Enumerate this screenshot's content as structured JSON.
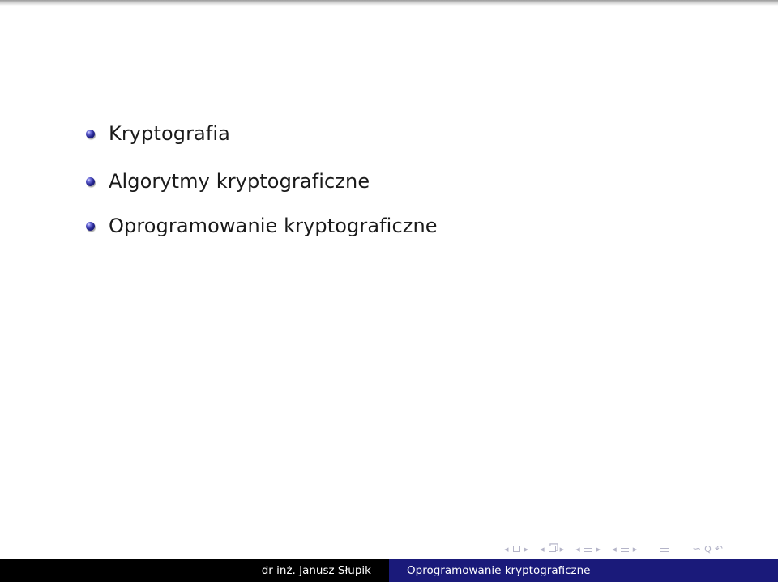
{
  "slide": {
    "items": [
      {
        "text": "Kryptografia"
      },
      {
        "text": "Algorytmy kryptograficzne"
      },
      {
        "text": "Oprogramowanie kryptograficzne"
      }
    ]
  },
  "footer": {
    "author": "dr inż. Janusz Słupik",
    "title": "Oprogramowanie kryptograficzne"
  },
  "navigation": {
    "prev_glyph": "◂",
    "next_glyph": "▸",
    "search_glyph": "∽",
    "zoom_glyph": "Q",
    "back_glyph": "↶"
  },
  "colors": {
    "footer_left_bg": "#000000",
    "footer_right_bg": "#1a1a7a",
    "bullet": "#262690",
    "nav": "#b4b4c8"
  }
}
